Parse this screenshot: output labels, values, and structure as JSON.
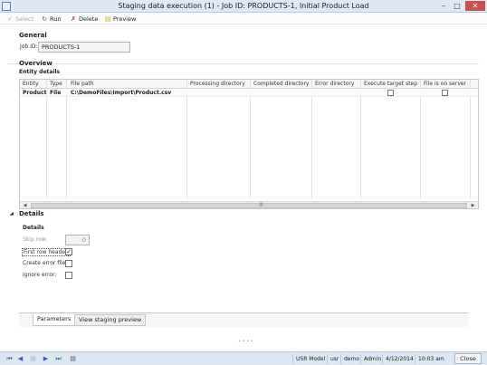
{
  "window": {
    "title": "Staging data execution (1) - Job ID: PRODUCTS-1, Initial Product Load",
    "minimize": "–",
    "maximize": "□",
    "close": "✕"
  },
  "toolbar": {
    "select": "Select",
    "run": "Run",
    "delete": "Delete",
    "preview": "Preview"
  },
  "general": {
    "heading": "General",
    "job_id_label": "Job ID:",
    "job_id_value": "PRODUCTS-1"
  },
  "overview": {
    "heading": "Overview",
    "entity_details": "Entity details",
    "columns": [
      "Entity",
      "Type",
      "File path",
      "Processing directory",
      "Completed directory",
      "Error directory",
      "Execute target step",
      "File is on server"
    ],
    "rows": [
      {
        "entity": "Product",
        "type": "File",
        "file_path": "C:\\DemoFiles\\Import\\Product.csv",
        "execute_target_step": false,
        "file_on_server": false
      }
    ]
  },
  "details": {
    "heading": "Details",
    "subheading": "Details",
    "skip_row_label": "Skip row:",
    "skip_row_value": "0",
    "first_row_header_label": "First row header:",
    "first_row_header_checked": true,
    "create_error_file_label": "Create error file:",
    "create_error_file_checked": false,
    "ignore_error_label": "Ignore error:",
    "ignore_error_checked": false
  },
  "tabs": [
    {
      "label": "Parameters",
      "active": true
    },
    {
      "label": "View staging preview",
      "active": false
    }
  ],
  "statusbar": {
    "model": "USR Model",
    "layer": "usr",
    "company": "demo",
    "user": "Admin",
    "date": "4/12/2014",
    "time": "10:03 am",
    "close": "Close"
  }
}
